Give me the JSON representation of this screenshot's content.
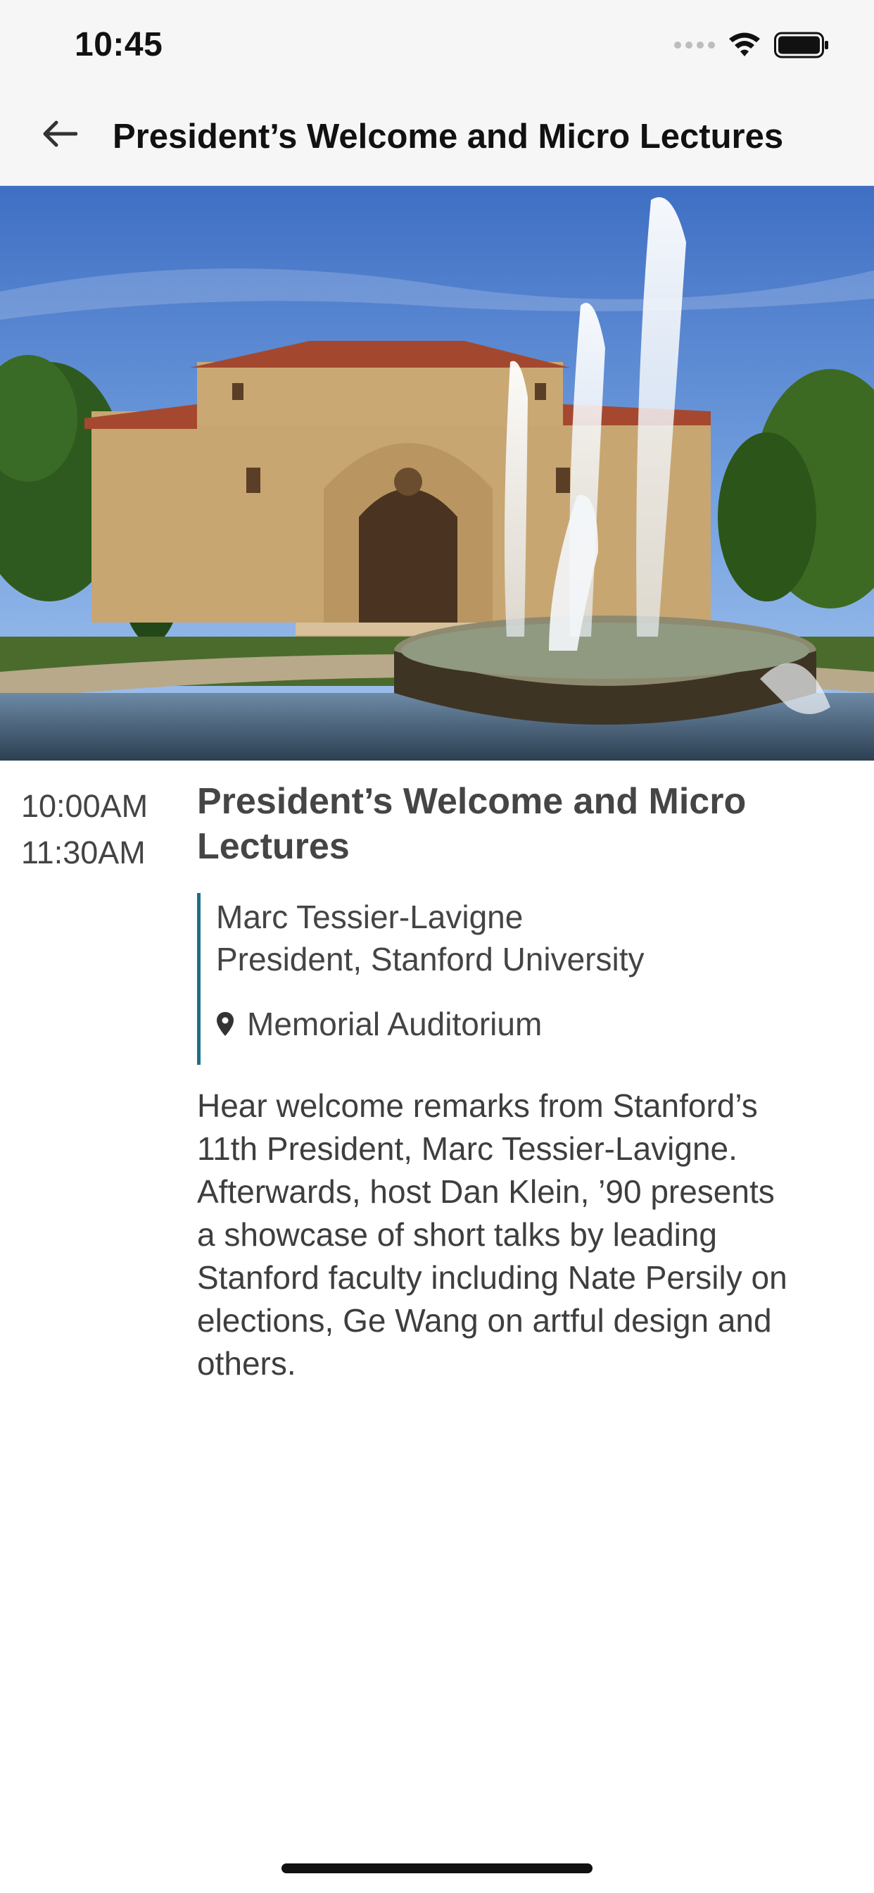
{
  "status_bar": {
    "time": "10:45"
  },
  "header": {
    "title": "President’s Welcome and Micro Lectures"
  },
  "hero": {
    "image": "Memorial Auditorium fountain photo"
  },
  "event": {
    "start_time": "10:00AM",
    "end_time": "11:30AM",
    "title": "President’s Welcome and Micro Lectures",
    "speaker_name": "Marc Tessier-Lavigne",
    "speaker_role": "President, Stanford University",
    "location": "Memorial Auditorium",
    "description": "Hear welcome remarks from Stanford’s 11th President, Marc Tessier-Lavigne. Afterwards, host Dan Klein, ’90 presents a showcase of short talks by leading Stanford faculty including Nate Persily on elections, Ge Wang on artful design and others."
  },
  "colors": {
    "accent_bar": "#1d6f86",
    "header_bg": "#f6f6f6",
    "text": "#444444"
  },
  "icons": {
    "back": "arrow-left-icon",
    "location": "map-pin-icon",
    "wifi": "wifi-icon",
    "battery": "battery-icon",
    "signal": "signal-icon"
  }
}
